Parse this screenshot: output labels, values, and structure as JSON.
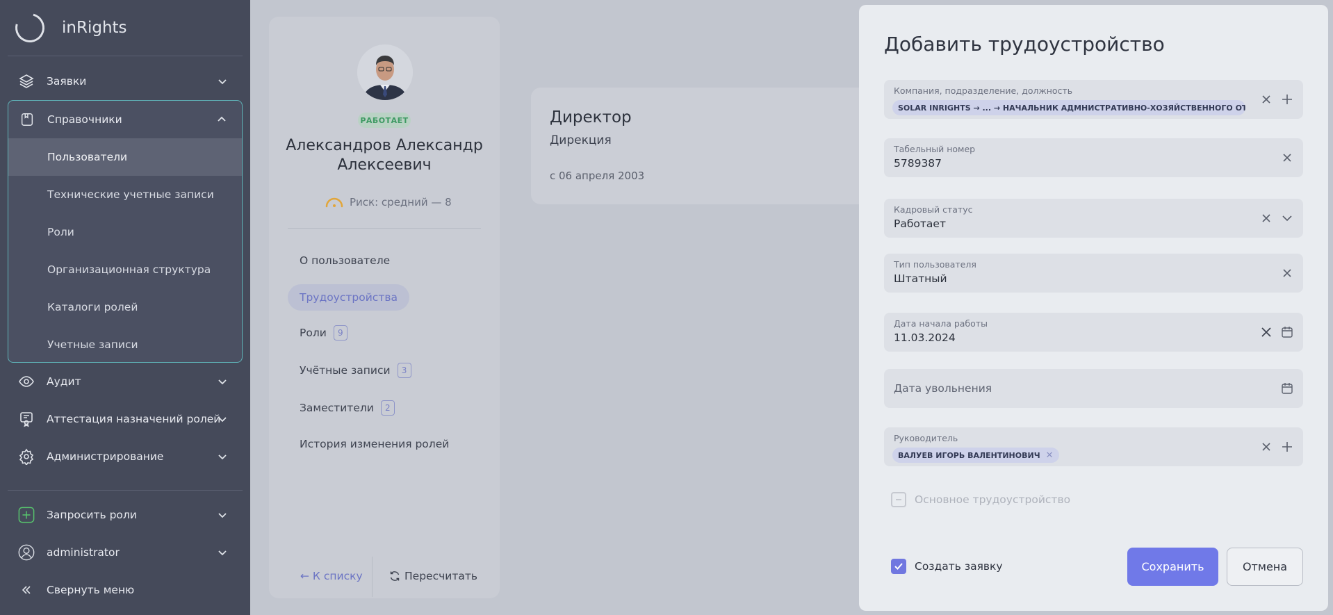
{
  "app": {
    "name": "inRights"
  },
  "sidebar": {
    "requests": "Заявки",
    "directories": "Справочники",
    "sub_items": [
      {
        "label": "Пользователи"
      },
      {
        "label": "Технические учетные записи"
      },
      {
        "label": "Роли"
      },
      {
        "label": "Организационная структура"
      },
      {
        "label": "Каталоги ролей"
      },
      {
        "label": "Учетные записи"
      }
    ],
    "audit": "Аудит",
    "attestation": "Аттестация назначений ролей",
    "admin": "Администрирование",
    "request_roles": "Запросить роли",
    "user": "administrator",
    "collapse": "Свернуть меню"
  },
  "profile": {
    "status": "РАБОТАЕТ",
    "name_line1": "Александров Александр",
    "name_line2": "Алексеевич",
    "risk": "Риск: средний — 8",
    "menu": {
      "about": "О пользователе",
      "employment": "Трудоустройства",
      "roles": "Роли",
      "roles_count": "9",
      "accounts": "Учётные записи",
      "accounts_count": "3",
      "deputies": "Заместители",
      "deputies_count": "2",
      "history": "История изменения ролей"
    },
    "back": "← К списку",
    "recalc": "Пересчитать"
  },
  "employment_card": {
    "title": "Директор",
    "department": "Дирекция",
    "since": "с 06 апреля 2003"
  },
  "modal": {
    "title": "Добавить трудоустройство",
    "company_label": "Компания, подразделение, должность",
    "company_tag": "SOLAR INRIGHTS → ... → НАЧАЛЬНИК АДМНИСТРАТИВНО-ХОЗЯЙСТВЕННОГО ОТ...",
    "tabnum_label": "Табельный номер",
    "tabnum_value": "5789387",
    "hr_status_label": "Кадровый статус",
    "hr_status_value": "Работает",
    "user_type_label": "Тип пользователя",
    "user_type_value": "Штатный",
    "start_label": "Дата начала работы",
    "start_value": "11.03.2024",
    "dismissal_placeholder": "Дата увольнения",
    "manager_label": "Руководитель",
    "manager_tag": "ВАЛУЕВ ИГОРЬ ВАЛЕНТИНОВИЧ",
    "main_employment": "Основное трудоустройство",
    "create_request": "Создать заявку",
    "save": "Сохранить",
    "cancel": "Отмена"
  }
}
